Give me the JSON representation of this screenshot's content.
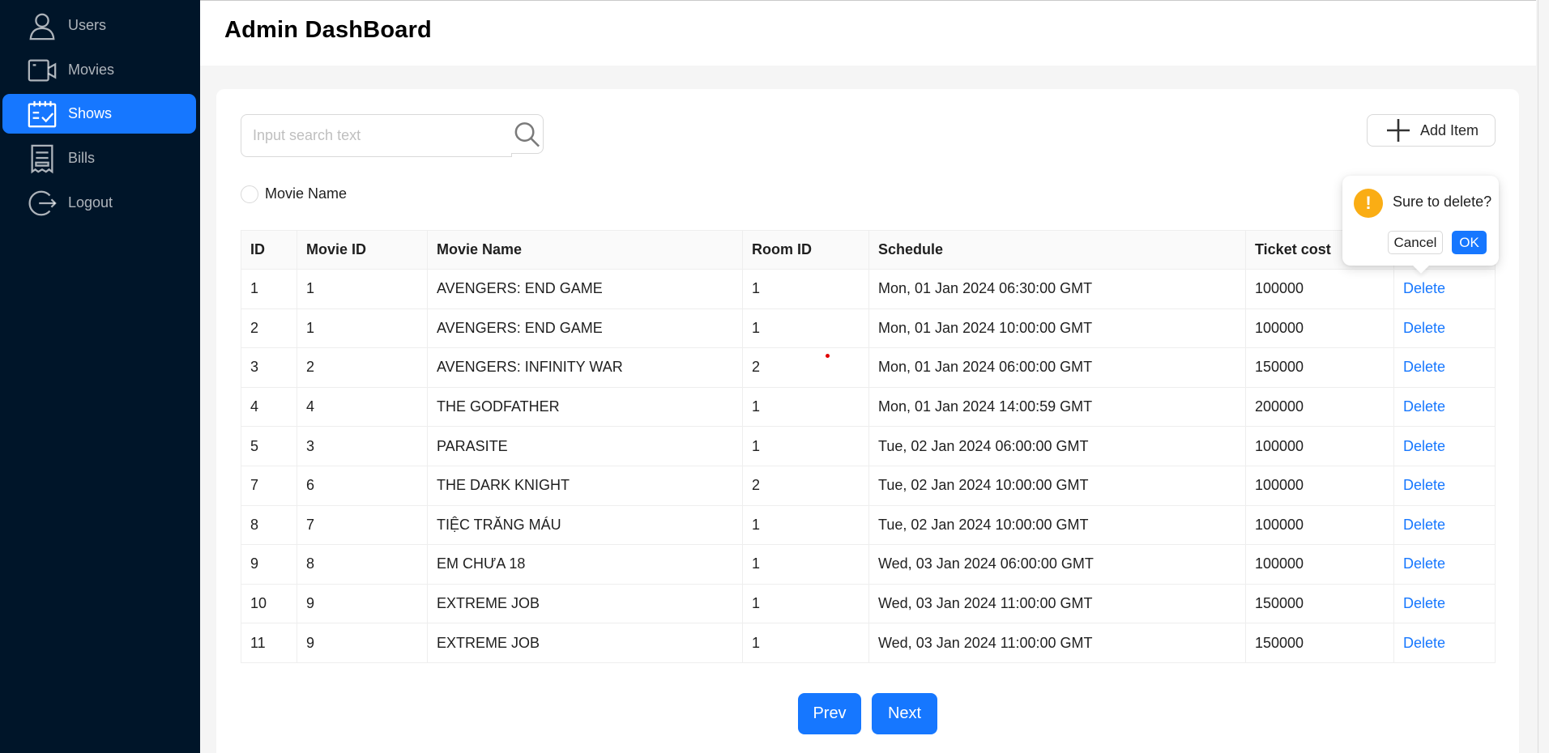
{
  "sidebar": {
    "items": [
      {
        "label": "Users",
        "icon": "user-icon",
        "active": false
      },
      {
        "label": "Movies",
        "icon": "video-camera-icon",
        "active": false
      },
      {
        "label": "Shows",
        "icon": "schedule-icon",
        "active": true
      },
      {
        "label": "Bills",
        "icon": "receipt-icon",
        "active": false
      },
      {
        "label": "Logout",
        "icon": "logout-icon",
        "active": false
      }
    ]
  },
  "header": {
    "title": "Admin DashBoard"
  },
  "toolbar": {
    "search_placeholder": "Input search text",
    "search_value": "",
    "add_label": "Add Item",
    "filter_label": "Movie Name"
  },
  "table": {
    "columns": [
      "ID",
      "Movie ID",
      "Movie Name",
      "Room ID",
      "Schedule",
      "Ticket cost",
      ""
    ],
    "rows": [
      [
        "1",
        "1",
        "AVENGERS: END GAME",
        "1",
        "Mon, 01 Jan 2024 06:30:00 GMT",
        "100000",
        "Delete"
      ],
      [
        "2",
        "1",
        "AVENGERS: END GAME",
        "1",
        "Mon, 01 Jan 2024 10:00:00 GMT",
        "100000",
        "Delete"
      ],
      [
        "3",
        "2",
        "AVENGERS: INFINITY WAR",
        "2",
        "Mon, 01 Jan 2024 06:00:00 GMT",
        "150000",
        "Delete"
      ],
      [
        "4",
        "4",
        "THE GODFATHER",
        "1",
        "Mon, 01 Jan 2024 14:00:59 GMT",
        "200000",
        "Delete"
      ],
      [
        "5",
        "3",
        "PARASITE",
        "1",
        "Tue, 02 Jan 2024 06:00:00 GMT",
        "100000",
        "Delete"
      ],
      [
        "7",
        "6",
        "THE DARK KNIGHT",
        "2",
        "Tue, 02 Jan 2024 10:00:00 GMT",
        "100000",
        "Delete"
      ],
      [
        "8",
        "7",
        "TIỆC TRĂNG MÁU",
        "1",
        "Tue, 02 Jan 2024 10:00:00 GMT",
        "100000",
        "Delete"
      ],
      [
        "9",
        "8",
        "EM CHƯA 18",
        "1",
        "Wed, 03 Jan 2024 06:00:00 GMT",
        "100000",
        "Delete"
      ],
      [
        "10",
        "9",
        "EXTREME JOB",
        "1",
        "Wed, 03 Jan 2024 11:00:00 GMT",
        "150000",
        "Delete"
      ],
      [
        "11",
        "9",
        "EXTREME JOB",
        "1",
        "Wed, 03 Jan 2024 11:00:00 GMT",
        "150000",
        "Delete"
      ]
    ]
  },
  "pagination": {
    "prev_label": "Prev",
    "next_label": "Next"
  },
  "popconfirm": {
    "icon_glyph": "!",
    "title": "Sure to delete?",
    "cancel_label": "Cancel",
    "ok_label": "OK"
  },
  "colors": {
    "sidebar_bg": "#001529",
    "primary": "#1677ff",
    "warning": "#faad14"
  }
}
